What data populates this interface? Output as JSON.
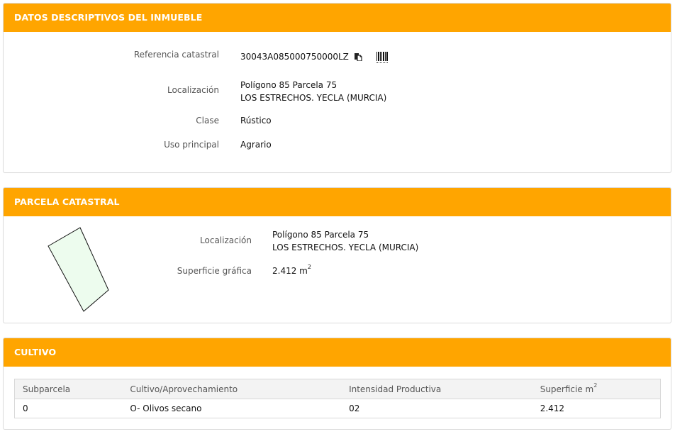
{
  "datos": {
    "title": "DATOS DESCRIPTIVOS DEL INMUEBLE",
    "ref_label": "Referencia catastral",
    "ref_value": "30043A085000750000LZ",
    "loc_label": "Localización",
    "loc_line1": "Polígono 85 Parcela 75",
    "loc_line2": "LOS ESTRECHOS. YECLA (MURCIA)",
    "clase_label": "Clase",
    "clase_value": "Rústico",
    "uso_label": "Uso principal",
    "uso_value": "Agrario"
  },
  "parcela": {
    "title": "PARCELA CATASTRAL",
    "loc_label": "Localización",
    "loc_line1": "Polígono 85 Parcela 75",
    "loc_line2": "LOS ESTRECHOS. YECLA (MURCIA)",
    "sup_label": "Superficie gráfica",
    "sup_value": "2.412 m",
    "sup_exp": "2"
  },
  "cultivo": {
    "title": "CULTIVO",
    "headers": [
      "Subparcela",
      "Cultivo/Aprovechamiento",
      "Intensidad Productiva",
      "Superficie m"
    ],
    "header_exp": "2",
    "rows": [
      [
        "0",
        "O- Olivos secano",
        "02",
        "2.412"
      ]
    ]
  },
  "colors": {
    "header_bg": "#ffa500",
    "parcel_fill": "#edfcee"
  },
  "icons": [
    "copy-icon",
    "barcode-icon"
  ]
}
